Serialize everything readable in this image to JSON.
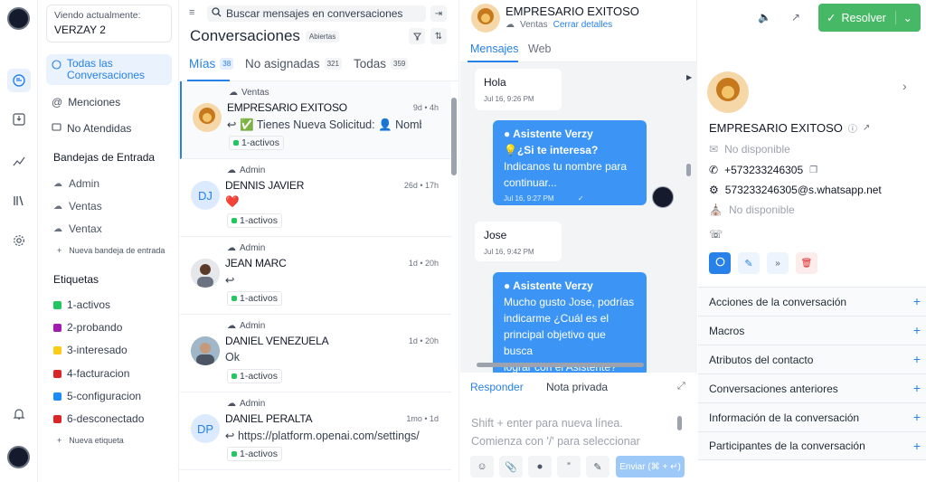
{
  "sidebar": {
    "viewing_label": "Viendo actualmente:",
    "viewing_value": "VERZAY 2",
    "nav": [
      {
        "label": "Todas las Conversaciones",
        "icon": "chat-bubble-icon"
      },
      {
        "label": "Menciones",
        "icon": "at-icon"
      },
      {
        "label": "No Atendidas",
        "icon": "inbox-icon"
      }
    ],
    "inboxes_title": "Bandejas de Entrada",
    "inboxes": [
      "Admin",
      "Ventas",
      "Ventax"
    ],
    "new_inbox": "Nueva bandeja de entrada",
    "labels_title": "Etiquetas",
    "labels": [
      {
        "name": "1-activos",
        "color": "#22c55e"
      },
      {
        "name": "2-probando",
        "color": "#a21caf"
      },
      {
        "name": "3-interesado",
        "color": "#facc15"
      },
      {
        "name": "4-facturacion",
        "color": "#dc2626"
      },
      {
        "name": "5-configuracion",
        "color": "#1d8cf8"
      },
      {
        "name": "6-desconectado",
        "color": "#dc2626"
      }
    ],
    "new_label": "Nueva etiqueta"
  },
  "convlist": {
    "search_placeholder": "Buscar mensajes en conversaciones",
    "title": "Conversaciones",
    "status": "Abiertas",
    "tabs": [
      {
        "label": "Mías",
        "count": "38"
      },
      {
        "label": "No asignadas",
        "count": "321"
      },
      {
        "label": "Todas",
        "count": "359"
      }
    ],
    "items": [
      {
        "inbox": "Ventas",
        "name": "EMPRESARIO EXITOSO",
        "time": "9d • 4h",
        "message": "↩ ✅ Tienes Nueva Solicitud: 👤 Nombre:",
        "label": "1-activos",
        "avatar": ""
      },
      {
        "inbox": "Admin",
        "name": "DENNIS JAVIER",
        "time": "26d • 17h",
        "message": "❤️",
        "label": "1-activos",
        "avatar": "DJ"
      },
      {
        "inbox": "Admin",
        "name": "JEAN MARC",
        "time": "1d • 20h",
        "message": "↩",
        "label": "1-activos",
        "avatar": ""
      },
      {
        "inbox": "Admin",
        "name": "DANIEL VENEZUELA",
        "time": "1d • 20h",
        "message": "Ok",
        "label": "1-activos",
        "avatar": ""
      },
      {
        "inbox": "Admin",
        "name": "DANIEL PERALTA",
        "time": "1mo • 1d",
        "message": "↩ https://platform.openai.com/settings/",
        "label": "1-activos",
        "avatar": "DP"
      }
    ]
  },
  "chat": {
    "contact_name": "EMPRESARIO EXITOSO",
    "inbox": "Ventas",
    "close_details": "Cerrar detalles",
    "tabs": [
      "Mensajes",
      "Web"
    ],
    "messages": [
      {
        "type": "in",
        "text": "Hola",
        "time": "Jul 16, 9:26 PM"
      },
      {
        "type": "out",
        "who": "Asistente Verzy",
        "lines": [
          "💡¿Si te interesa?",
          "Indicanos tu nombre para",
          "continuar..."
        ],
        "time": "Jul 16, 9:27 PM"
      },
      {
        "type": "in",
        "text": "Jose",
        "time": "Jul 16, 9:42 PM"
      },
      {
        "type": "out",
        "who": "Asistente Verzy",
        "lines": [
          "Mucho gusto Jose, podrías",
          "indicarme ¿Cuál es el",
          "principal objetivo que busca",
          "lograr con el Asistente?"
        ],
        "time": ""
      }
    ],
    "reply_tabs": [
      "Responder",
      "Nota privada"
    ],
    "placeholder_1": "Shift + enter para nueva línea.",
    "placeholder_2": "Comienza con '/' para seleccionar",
    "send": "Enviar (⌘ + ↵)",
    "resolve": "Resolver"
  },
  "panel": {
    "name": "EMPRESARIO EXITOSO",
    "email": "No disponible",
    "phone": "+573233246305",
    "whatsapp": "573233246305@s.whatsapp.net",
    "company": "No disponible",
    "sections": [
      "Acciones de la conversación",
      "Macros",
      "Atributos del contacto",
      "Conversaciones anteriores",
      "Información de la conversación",
      "Participantes de la conversación"
    ]
  }
}
